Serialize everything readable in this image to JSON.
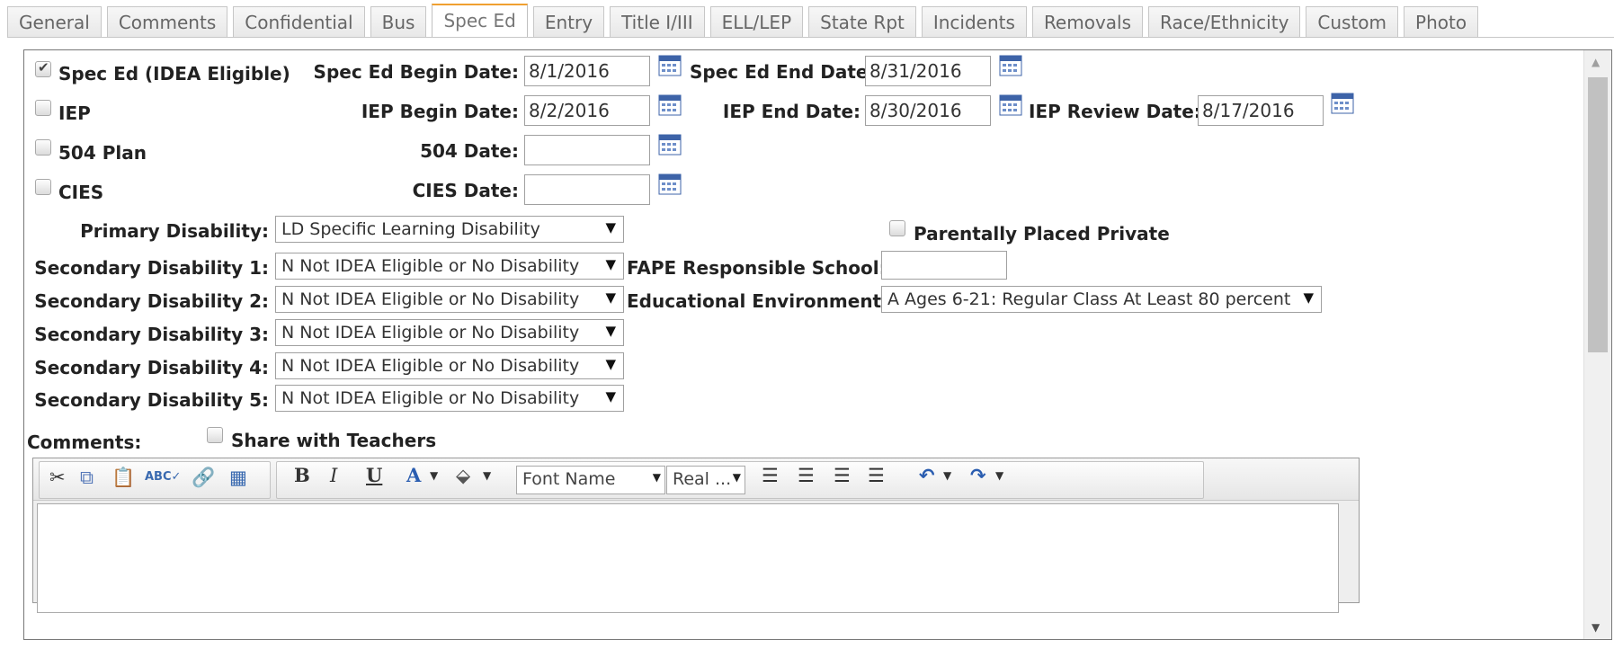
{
  "tabs": [
    "General",
    "Comments",
    "Confidential",
    "Bus",
    "Spec Ed",
    "Entry",
    "Title I/III",
    "ELL/LEP",
    "State Rpt",
    "Incidents",
    "Removals",
    "Race/Ethnicity",
    "Custom",
    "Photo"
  ],
  "active_tab": "Spec Ed",
  "form": {
    "spec_ed_label": "Spec Ed (IDEA Eligible)",
    "spec_ed_checked": true,
    "spec_ed_begin_label": "Spec Ed Begin Date:",
    "spec_ed_begin_value": "8/1/2016",
    "spec_ed_end_label": "Spec Ed End Date:",
    "spec_ed_end_value": "8/31/2016",
    "iep_label": "IEP",
    "iep_begin_label": "IEP Begin Date:",
    "iep_begin_value": "8/2/2016",
    "iep_end_label": "IEP End Date:",
    "iep_end_value": "8/30/2016",
    "iep_review_label": "IEP Review Date:",
    "iep_review_value": "8/17/2016",
    "plan504_label": "504 Plan",
    "date504_label": "504 Date:",
    "date504_value": "",
    "cies_label": "CIES",
    "cies_date_label": "CIES Date:",
    "cies_date_value": "",
    "primary_disability_label": "Primary Disability:",
    "primary_disability_value": "LD Specific Learning Disability",
    "parentally_placed_label": "Parentally Placed Private",
    "secondary": [
      {
        "label": "Secondary Disability 1:",
        "value": "N Not IDEA Eligible or No Disability"
      },
      {
        "label": "Secondary Disability 2:",
        "value": "N Not IDEA Eligible or No Disability"
      },
      {
        "label": "Secondary Disability 3:",
        "value": "N Not IDEA Eligible or No Disability"
      },
      {
        "label": "Secondary Disability 4:",
        "value": "N Not IDEA Eligible or No Disability"
      },
      {
        "label": "Secondary Disability 5:",
        "value": "N Not IDEA Eligible or No Disability"
      }
    ],
    "fape_label": "FAPE Responsible School:",
    "fape_value": "",
    "edu_env_label": "Educational Environment:",
    "edu_env_value": "A Ages 6-21: Regular Class At Least 80 percent",
    "comments_label": "Comments:",
    "share_label": "Share with Teachers"
  },
  "toolbar": {
    "bold": "B",
    "italic": "I",
    "underline": "U",
    "font_color": "A",
    "font_name": "Font Name",
    "font_size": "Real ..."
  },
  "icons": [
    "cut-icon",
    "copy-icon",
    "paste-icon",
    "spellcheck-icon",
    "link-icon",
    "table-icon",
    "fill-color-icon",
    "align-left-icon",
    "align-center-icon",
    "align-right-icon",
    "justify-icon",
    "undo-icon",
    "redo-icon",
    "calendar-icon"
  ],
  "colors": {
    "tab_active_accent": "#f0a030",
    "link_blue": "#2a5db0"
  }
}
